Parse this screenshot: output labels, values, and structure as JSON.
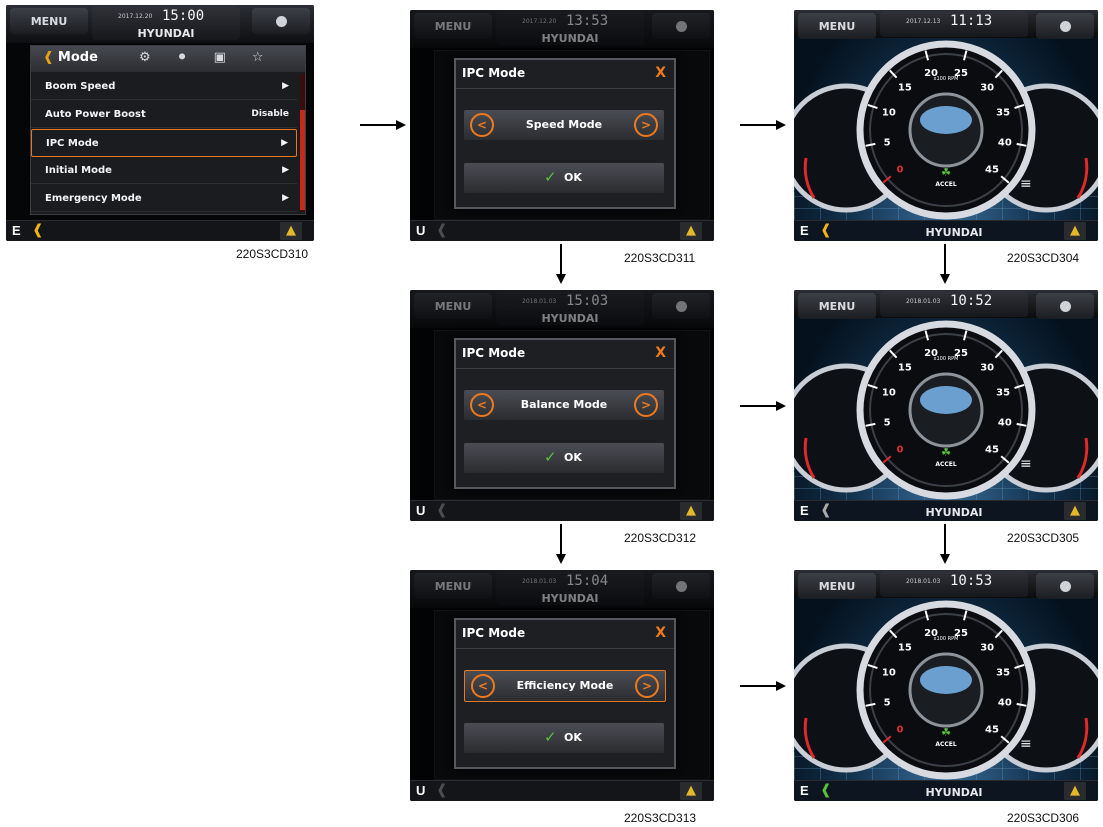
{
  "screens": {
    "s310": {
      "menu_label": "MENU",
      "date": "2017.12.20",
      "time": "15:00",
      "brand": "HYUNDAI",
      "mode_title": "Mode",
      "rows": [
        {
          "label": "Boom Speed",
          "value": "▶"
        },
        {
          "label": "Auto Power Boost",
          "value": "Disable"
        },
        {
          "label": "IPC Mode",
          "value": "▶"
        },
        {
          "label": "Initial Mode",
          "value": "▶"
        },
        {
          "label": "Emergency Mode",
          "value": "▶"
        }
      ],
      "bottom_letter": "E",
      "caption": "220S3CD310"
    },
    "s311": {
      "menu_label": "MENU",
      "date": "2017.12.20",
      "time": "13:53",
      "brand": "HYUNDAI",
      "popup_title": "IPC Mode",
      "mode": "Speed Mode",
      "ok": "OK",
      "bottom_letter": "U",
      "caption": "220S3CD311"
    },
    "s312": {
      "menu_label": "MENU",
      "date": "2018.01.03",
      "time": "15:03",
      "brand": "HYUNDAI",
      "popup_title": "IPC Mode",
      "mode": "Balance Mode",
      "ok": "OK",
      "bottom_letter": "U",
      "caption": "220S3CD312"
    },
    "s313": {
      "menu_label": "MENU",
      "date": "2018.01.03",
      "time": "15:04",
      "brand": "HYUNDAI",
      "popup_title": "IPC Mode",
      "mode": "Efficiency Mode",
      "ok": "OK",
      "bottom_letter": "U",
      "caption": "220S3CD313"
    },
    "s304": {
      "menu_label": "MENU",
      "date": "2017.12.13",
      "time": "11:13",
      "brand": "HYUNDAI",
      "rpm_unit": "x100 RPM",
      "accel": "ACCEL",
      "bottom_letter": "E",
      "caption": "220S3CD304"
    },
    "s305": {
      "menu_label": "MENU",
      "date": "2018.01.03",
      "time": "10:52",
      "brand": "HYUNDAI",
      "rpm_unit": "x100 RPM",
      "accel": "ACCEL",
      "bottom_letter": "E",
      "caption": "220S3CD305"
    },
    "s306": {
      "menu_label": "MENU",
      "date": "2018.01.03",
      "time": "10:53",
      "brand": "HYUNDAI",
      "rpm_unit": "x100 RPM",
      "accel": "ACCEL",
      "bottom_letter": "E",
      "caption": "220S3CD306"
    }
  },
  "gauge_ticks": [
    "5",
    "10",
    "15",
    "20",
    "25",
    "30",
    "35",
    "40",
    "45"
  ],
  "gauge_zero": "0",
  "colors": {
    "accent": "#ef7a1e",
    "ok_check": "#58c23a",
    "icon_yellow": "#f0b318"
  }
}
